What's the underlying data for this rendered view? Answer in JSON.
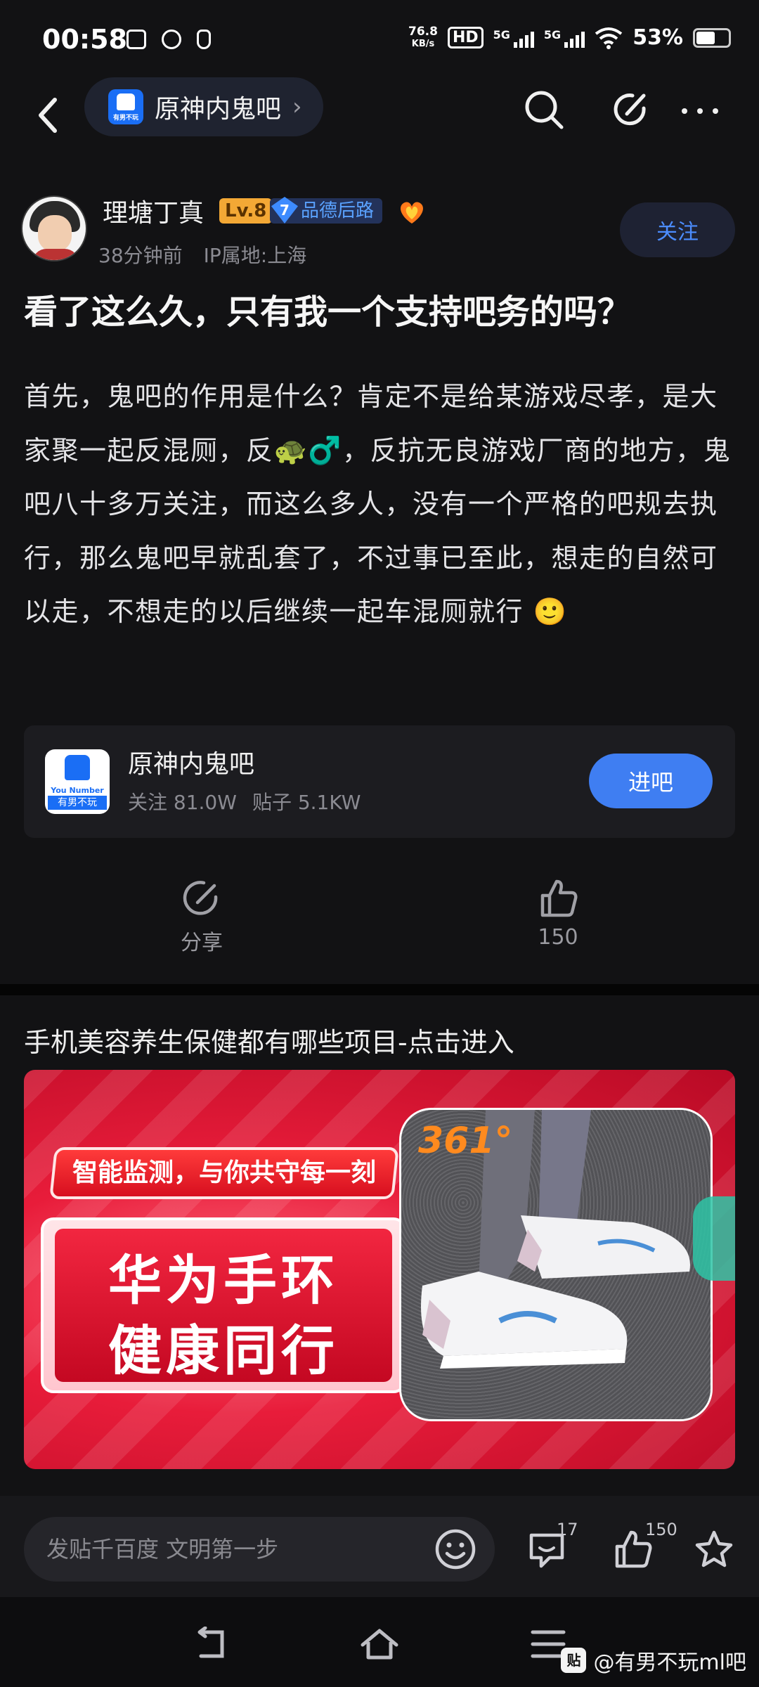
{
  "status_bar": {
    "time": "00:58",
    "net_speed_value": "76.8",
    "net_speed_unit": "KB/s",
    "hd_label": "HD",
    "signal_label_1": "5G",
    "signal_label_2": "5G",
    "battery": "53%"
  },
  "nav": {
    "forum_name": "原神内鬼吧",
    "chevron": "›",
    "icons": [
      "back-icon",
      "search-icon",
      "compose-icon",
      "more-icon"
    ]
  },
  "post": {
    "author": "理塘丁真",
    "level": "Lv.8",
    "medal_number": "7",
    "medal_text": "品德后路",
    "time_ago": "38分钟前",
    "ip_location": "IP属地:上海",
    "follow_label": "关注",
    "title": "看了这么久，只有我一个支持吧务的吗？",
    "body": "首先，鬼吧的作用是什么？肯定不是给某游戏尽孝，是大家聚一起反混厕，反🐢♂️，反抗无良游戏厂商的地方，鬼吧八十多万关注，而这么多人，没有一个严格的吧规去执行，那么鬼吧早就乱套了，不过事已至此，想走的自然可以走，不想走的以后继续一起车混厕就行 🙂"
  },
  "forum_card": {
    "name": "原神内鬼吧",
    "logo_en": "You Number One",
    "logo_cn": "有男不玩",
    "followers": "关注 81.0W",
    "posts": "贴子 5.1KW",
    "enter_label": "进吧"
  },
  "actions": {
    "share_label": "分享",
    "like_count": "150"
  },
  "ad": {
    "title": "手机美容养生保健都有哪些项目-点击进入",
    "slogan": "智能监测，与你共守每一刻",
    "line1": "华为手环",
    "line2": "健康同行",
    "brand": "361°"
  },
  "comment_bar": {
    "placeholder": "发贴千百度 文明第一步",
    "comment_count": "17",
    "like_count": "150"
  },
  "watermark": {
    "logo": "贴",
    "text": "@有男不玩ml吧"
  },
  "colors": {
    "background": "#121214",
    "accent": "#3f7ef2",
    "level_badge": "#f3a835",
    "ad_red": "#e81c3a"
  }
}
